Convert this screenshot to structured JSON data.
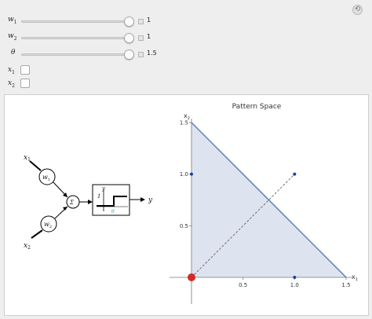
{
  "controls": {
    "sliders": [
      {
        "label": "w",
        "sub": "1",
        "value_text": "1",
        "fraction": 0.98
      },
      {
        "label": "w",
        "sub": "2",
        "value_text": "1",
        "fraction": 0.98
      },
      {
        "label": "θ",
        "sub": "",
        "value_text": "1.5",
        "fraction": 0.98
      }
    ],
    "checkboxes": [
      {
        "label": "x",
        "sub": "1",
        "checked": false
      },
      {
        "label": "x",
        "sub": "2",
        "checked": false
      }
    ]
  },
  "diagram": {
    "input1": "x",
    "input1_sub": "1",
    "input2": "x",
    "input2_sub": "2",
    "weight1": "w",
    "weight1_sub": "1",
    "weight2": "w",
    "weight2_sub": "2",
    "sum_symbol": "Σ",
    "step_y_label": "y",
    "step_one_label": "1",
    "threshold_label": "θ",
    "output_label": "y"
  },
  "chart_data": {
    "type": "scatter",
    "title": "Pattern Space",
    "xlabel": "x",
    "xlabel_sub": "1",
    "ylabel": "x",
    "ylabel_sub": "2",
    "xlim": [
      0,
      1.5
    ],
    "ylim": [
      0,
      1.5
    ],
    "xticks": [
      "0.5",
      "1.0",
      "1.5"
    ],
    "yticks": [
      "0.5",
      "1.0",
      "1.5"
    ],
    "points": [
      {
        "x": 0,
        "y": 0,
        "color": "#d62828",
        "size": "large"
      },
      {
        "x": 1,
        "y": 0,
        "color": "#1f3fa6",
        "size": "small"
      },
      {
        "x": 0,
        "y": 1,
        "color": "#1f3fa6",
        "size": "small"
      },
      {
        "x": 1,
        "y": 1,
        "color": "#1f3fa6",
        "size": "small"
      }
    ],
    "decision_line": {
      "x0": 0,
      "y0": 1.5,
      "x1": 1.5,
      "y1": 0,
      "color": "#5b7fb7"
    },
    "region_fill": "#dde4ef",
    "weight_vector": {
      "x0": 0,
      "y0": 0,
      "x1": 1,
      "y1": 1
    }
  },
  "colors": {
    "accent_red": "#d62828",
    "point_blue": "#1f3fa6",
    "threshold_cyan": "#2aa5b5"
  }
}
